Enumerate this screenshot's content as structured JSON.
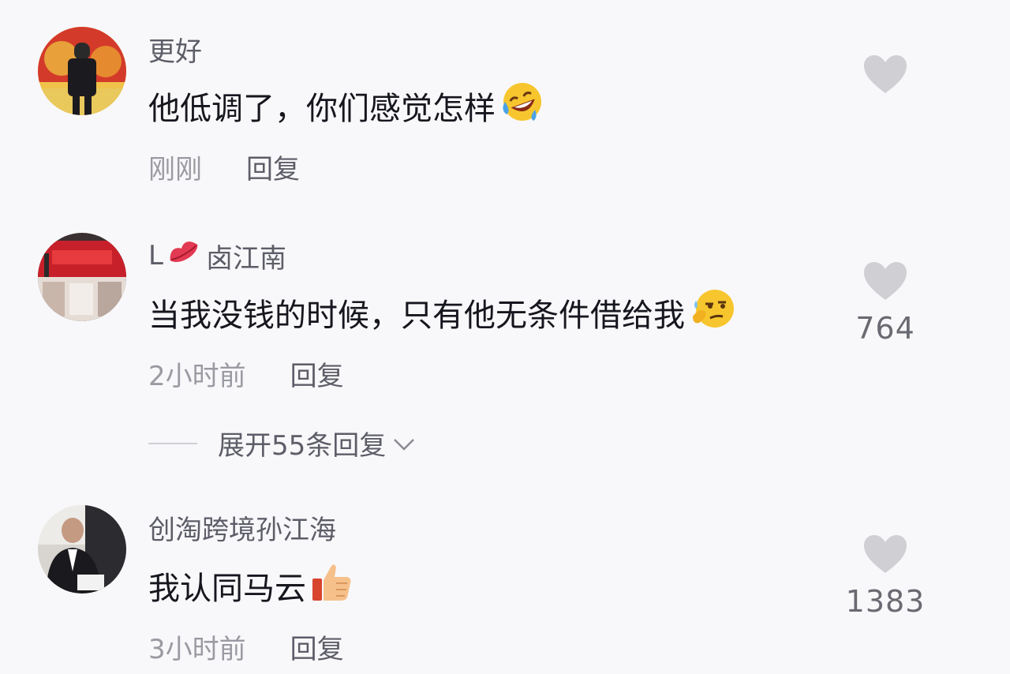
{
  "comments": [
    {
      "username": "更好",
      "text": "他低调了，你们感觉怎样",
      "emoji_icon": "rofl-emoji-icon",
      "time": "刚刚",
      "reply_label": "回复",
      "like_count": ""
    },
    {
      "username_prefix": "L",
      "username_icon": "lips-icon",
      "username": "卤江南",
      "text": "当我没钱的时候，只有他无条件借给我",
      "emoji_icon": "smirk-thinking-emoji-icon",
      "time": "2小时前",
      "reply_label": "回复",
      "like_count": "764",
      "expand_label": "展开55条回复"
    },
    {
      "username": "创淘跨境孙江海",
      "text": "我认同马云",
      "emoji_icon": "thumbs-up-emoji-icon",
      "time": "3小时前",
      "reply_label": "回复",
      "like_count": "1383"
    }
  ],
  "colors": {
    "background": "#f8f8fa",
    "text": "#16161e",
    "username": "#5d5d68",
    "meta": "#9a9aa2",
    "heart": "#cfcfd4"
  }
}
